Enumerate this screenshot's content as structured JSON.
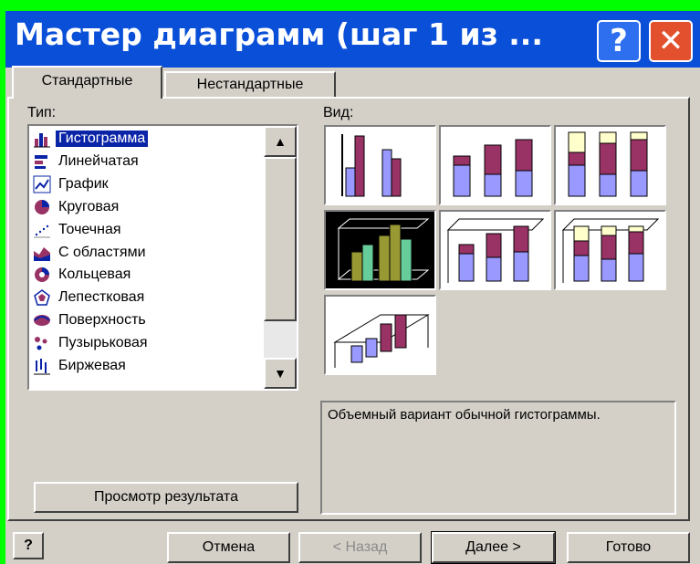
{
  "window": {
    "title": "Мастер диаграмм (шаг 1 из ...",
    "help_glyph": "?",
    "close_glyph": "✕"
  },
  "tabs": [
    {
      "label": "Стандартные",
      "active": true
    },
    {
      "label": "Нестандартные",
      "active": false
    }
  ],
  "type_label": "Тип:",
  "view_label": "Вид:",
  "chart_types": [
    {
      "label": "Гистограмма",
      "icon": "column-chart-icon",
      "selected": true
    },
    {
      "label": "Линейчатая",
      "icon": "bar-chart-icon"
    },
    {
      "label": "График",
      "icon": "line-chart-icon"
    },
    {
      "label": "Круговая",
      "icon": "pie-chart-icon"
    },
    {
      "label": "Точечная",
      "icon": "scatter-chart-icon"
    },
    {
      "label": "С областями",
      "icon": "area-chart-icon"
    },
    {
      "label": "Кольцевая",
      "icon": "doughnut-chart-icon"
    },
    {
      "label": "Лепестковая",
      "icon": "radar-chart-icon"
    },
    {
      "label": "Поверхность",
      "icon": "surface-chart-icon"
    },
    {
      "label": "Пузырьковая",
      "icon": "bubble-chart-icon"
    },
    {
      "label": "Биржевая",
      "icon": "stock-chart-icon"
    }
  ],
  "subtypes": [
    {
      "id": "clustered-column"
    },
    {
      "id": "stacked-column"
    },
    {
      "id": "100-stacked-column"
    },
    {
      "id": "3d-clustered-column",
      "selected": true
    },
    {
      "id": "3d-stacked-column"
    },
    {
      "id": "3d-100-stacked-column"
    },
    {
      "id": "3d-column"
    }
  ],
  "description": "Объемный вариант обычной гистограммы.",
  "buttons": {
    "preview": "Просмотр результата",
    "help_glyph": "?",
    "cancel": "Отмена",
    "back": "< Назад",
    "next": "Далее >",
    "finish": "Готово"
  },
  "colors": {
    "title_bar": "#0a4fd8",
    "selection": "#0a24a8",
    "series_blue": "#9999ff",
    "series_maroon": "#993366",
    "series_cream": "#ffffcc",
    "selected_green": "#66cc99",
    "selected_olive": "#999933"
  }
}
